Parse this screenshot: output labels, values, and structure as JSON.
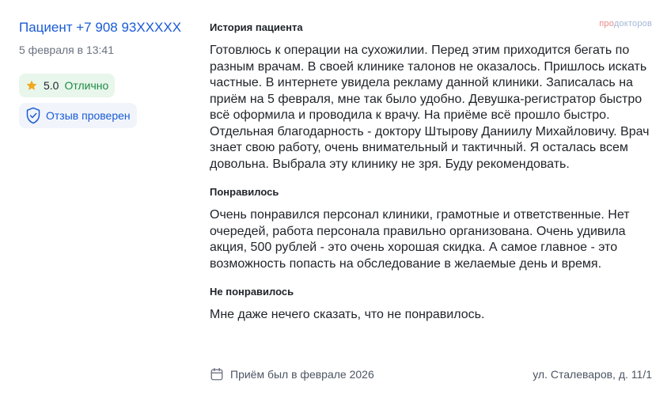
{
  "review": {
    "author": "Пациент +7 908 93XXXXX",
    "date": "5 февраля в 13:41",
    "rating_value": "5.0",
    "rating_text": "Отлично",
    "verified_label": "Отзыв проверен",
    "brand_pro": "про",
    "brand_rest": "докторов",
    "sections": [
      {
        "title": "История пациента",
        "text": "Готовлюсь к операции на сухожилии. Перед этим приходится бегать по разным врачам. В своей клинике талонов не оказалось. Пришлось искать частные. В интернете увидела рекламу данной клиники. Записалась на приём на 5 февраля, мне так было удобно. Девушка-регистратор быстро всё оформила и проводила к врачу. На приёме всё прошло быстро. Отдельная благодарность - доктору Штырову Даниилу Михайловичу. Врач знает свою работу, очень внимательный и тактичный. Я осталась всем довольна. Выбрала эту клинику не зря. Буду рекомендовать."
      },
      {
        "title": "Понравилось",
        "text": "Очень понравился персонал клиники, грамотные и ответственные. Нет очередей, работа персонала правильно организована. Очень удивила акция, 500 рублей - это очень хорошая скидка. А самое главное - это возможность попасть на обследование в желаемые день и время."
      },
      {
        "title": "Не понравилось",
        "text": "Мне даже нечего сказать, что не понравилось."
      }
    ],
    "visit_text": "Приём был в феврале 2026",
    "address": "ул. Сталеваров, д. 11/1"
  },
  "icons": {
    "star": "star-icon",
    "shield": "shield-check-icon",
    "calendar": "calendar-icon"
  },
  "colors": {
    "link": "#1a5bd6",
    "rating_bg": "#e8f6ec",
    "rating_text": "#1e8a44",
    "star": "#f2a81d",
    "verified_bg": "#f1f5fb"
  }
}
